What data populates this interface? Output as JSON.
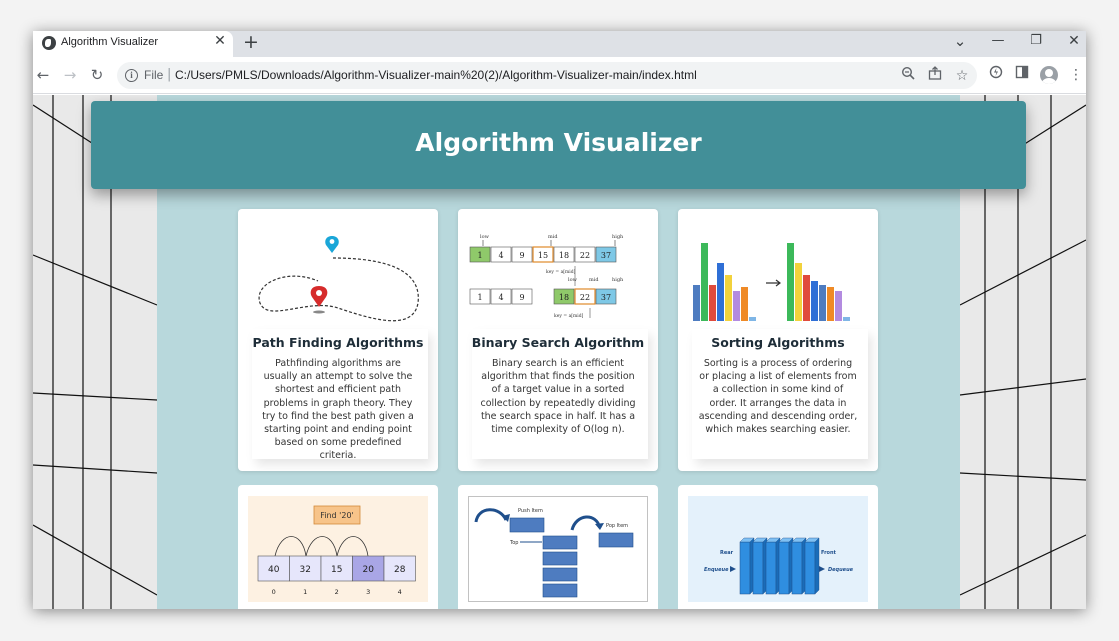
{
  "browser": {
    "tab_title": "Algorithm Visualizer",
    "tab_close": "✕",
    "new_tab": "+",
    "url_scheme": "File",
    "url": "C:/Users/PMLS/Downloads/Algorithm-Visualizer-main%20(2)/Algorithm-Visualizer-main/index.html",
    "window_controls": {
      "dropdown": "⌄",
      "minimize": "—",
      "restore": "❐",
      "close": "✕"
    },
    "nav": {
      "back": "←",
      "forward": "→",
      "reload": "↻"
    },
    "icons": {
      "zoom": "zoom-icon",
      "share": "share-icon",
      "bookmark": "star-icon",
      "extensions": "extensions-icon",
      "side_panel": "side-panel-icon",
      "profile": "profile-icon",
      "menu": "menu-icon"
    }
  },
  "header": {
    "title": "Algorithm Visualizer"
  },
  "cards": [
    {
      "title": "Path Finding Algorithms",
      "description": "Pathfinding algorithms are usually an attempt to solve the shortest and efficient path problems in graph theory. They try to find the best path given a starting point and ending point based on some predefined criteria."
    },
    {
      "title": "Binary Search Algorithm",
      "description": "Binary search is an efficient algorithm that finds the position of a target value in a sorted collection by repeatedly dividing the search space in half. It has a time complexity of O(log n)."
    },
    {
      "title": "Sorting Algorithms",
      "description": "Sorting is a process of ordering or placing a list of elements from a collection in some kind of order. It arranges the data in ascending and descending order, which makes searching easier."
    }
  ],
  "binary_search_image": {
    "row1": [
      "1",
      "4",
      "9",
      "15",
      "18",
      "22",
      "37"
    ],
    "row2": [
      "1",
      "4",
      "9",
      "18",
      "22",
      "37"
    ],
    "labels": {
      "low": "low",
      "mid": "mid",
      "high": "high",
      "key": "key = a[mid]"
    }
  },
  "linear_search_image": {
    "find_label": "Find '20'",
    "values": [
      "40",
      "32",
      "15",
      "20",
      "28"
    ],
    "indices": [
      "0",
      "1",
      "2",
      "3",
      "4"
    ]
  },
  "stack_image": {
    "push_label": "Push Item",
    "pop_label": "Pop Item",
    "top_label": "Top"
  },
  "queue_image": {
    "rear": "Rear",
    "front": "Front",
    "enqueue": "Enqueue",
    "dequeue": "Dequeue"
  },
  "colors": {
    "header": "#428f98",
    "panel": "#b8d8dc",
    "accent_green": "#3cb95a",
    "accent_blue": "#4e7cc0"
  }
}
